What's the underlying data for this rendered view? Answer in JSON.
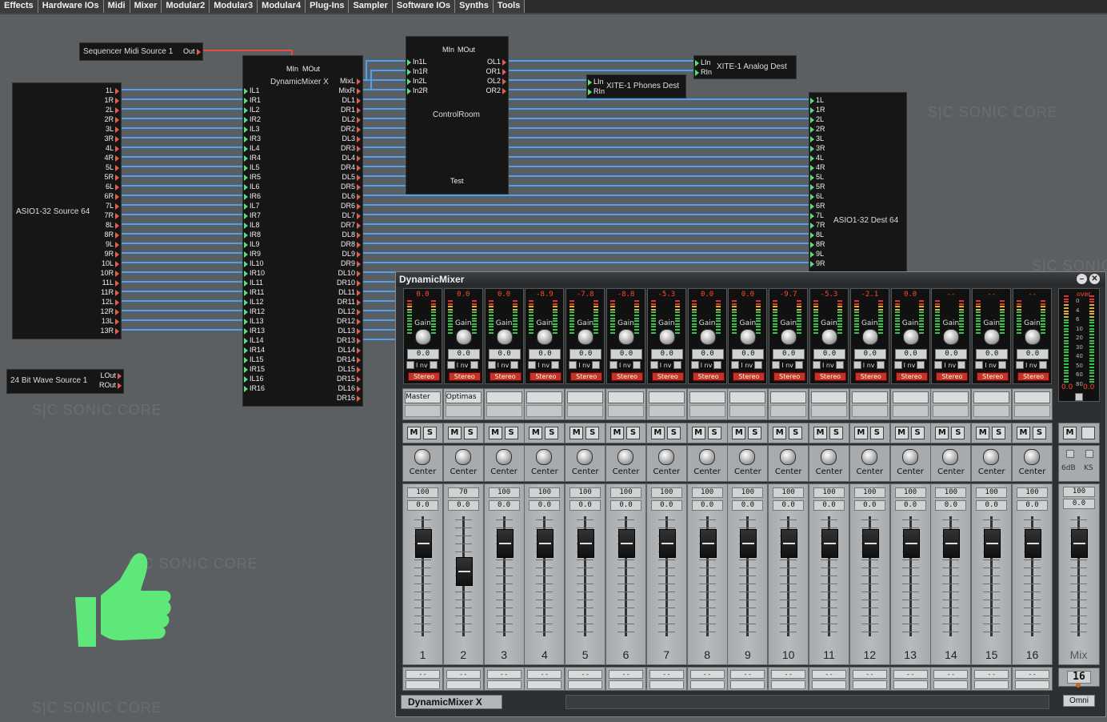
{
  "menu": [
    "Effects",
    "Hardware IOs",
    "Midi",
    "Mixer",
    "Modular2",
    "Modular3",
    "Modular4",
    "Plug-Ins",
    "Sampler",
    "Software IOs",
    "Synths",
    "Tools"
  ],
  "watermark": "S|C  SONIC CORE",
  "modules": {
    "seq": {
      "title": "Sequencer Midi Source 1",
      "out": "Out"
    },
    "asio_src": {
      "title": "ASIO1-32 Source 64",
      "ports": [
        "1L",
        "1R",
        "2L",
        "2R",
        "3L",
        "3R",
        "4L",
        "4R",
        "5L",
        "5R",
        "6L",
        "6R",
        "7L",
        "7R",
        "8L",
        "8R",
        "9L",
        "9R",
        "10L",
        "10R",
        "11L",
        "11R",
        "12L",
        "12R",
        "13L",
        "13R"
      ]
    },
    "wave": {
      "title": "24 Bit Wave Source 1",
      "ports": [
        "LOut",
        "ROut"
      ]
    },
    "dmx": {
      "title": "DynamicMixer X",
      "midi_in": "MIn",
      "midi_out": "MOut",
      "in_ports": [
        "IL1",
        "IR1",
        "IL2",
        "IR2",
        "IL3",
        "IR3",
        "IL4",
        "IR4",
        "IL5",
        "IR5",
        "IL6",
        "IR6",
        "IL7",
        "IR7",
        "IL8",
        "IR8",
        "IL9",
        "IR9",
        "IL10",
        "IR10",
        "IL11",
        "IR11",
        "IL12",
        "IR12",
        "IL13",
        "IR13",
        "IL14",
        "IR14",
        "IL15",
        "IR15",
        "IL16",
        "IR16"
      ],
      "out_ports": [
        "MixL",
        "MixR",
        "DL1",
        "DR1",
        "DL2",
        "DR2",
        "DL3",
        "DR3",
        "DL4",
        "DR4",
        "DL5",
        "DR5",
        "DL6",
        "DR6",
        "DL7",
        "DR7",
        "DL8",
        "DR8",
        "DL9",
        "DR9",
        "DL10",
        "DR10",
        "DL11",
        "DR11",
        "DL12",
        "DR12",
        "DL13",
        "DR13",
        "DL14",
        "DR14",
        "DL15",
        "DR15",
        "DL16",
        "DR16"
      ]
    },
    "cr": {
      "title": "ControlRoom",
      "midi_in": "MIn",
      "midi_out": "MOut",
      "in_ports": [
        "In1L",
        "In1R",
        "In2L",
        "In2R"
      ],
      "out_ports": [
        "OL1",
        "OR1",
        "OL2",
        "OR2"
      ],
      "test": "Test"
    },
    "xite_analog": {
      "title": "XITE-1 Analog Dest",
      "ports": [
        "LIn",
        "RIn"
      ]
    },
    "xite_phones": {
      "title": "XITE-1 Phones Dest",
      "ports": [
        "LIn",
        "RIn"
      ]
    },
    "asio_dest": {
      "title": "ASIO1-32 Dest 64",
      "ports": [
        "1L",
        "1R",
        "2L",
        "2R",
        "3L",
        "3R",
        "4L",
        "4R",
        "5L",
        "5R",
        "6L",
        "6R",
        "7L",
        "7R",
        "8L",
        "8R",
        "9L",
        "9R"
      ]
    }
  },
  "mixer": {
    "title": "DynamicMixer",
    "gain_label": "Gain",
    "inv_label": "I nv",
    "stereo_label": "Stereo",
    "mute_label": "M",
    "solo_label": "S",
    "footer": "DynamicMixer X",
    "channels": [
      {
        "num": "1",
        "peak": "0.0",
        "gain": "0.0",
        "name": "Master",
        "pan": "Center",
        "vol": "100",
        "vol_db": "0.0",
        "bottom": "- -",
        "fader": 0.78
      },
      {
        "num": "2",
        "peak": "0.0",
        "gain": "0.0",
        "name": "Optimas",
        "pan": "Center",
        "vol": "70",
        "vol_db": "0.0",
        "bottom": "- -",
        "fader": 0.55
      },
      {
        "num": "3",
        "peak": "0.0",
        "gain": "0.0",
        "name": "",
        "pan": "Center",
        "vol": "100",
        "vol_db": "0.0",
        "bottom": "- -",
        "fader": 0.78
      },
      {
        "num": "4",
        "peak": "-8.9",
        "gain": "0.0",
        "name": "",
        "pan": "Center",
        "vol": "100",
        "vol_db": "0.0",
        "bottom": "- -",
        "fader": 0.78
      },
      {
        "num": "5",
        "peak": "-7.8",
        "gain": "0.0",
        "name": "",
        "pan": "Center",
        "vol": "100",
        "vol_db": "0.0",
        "bottom": "- -",
        "fader": 0.78
      },
      {
        "num": "6",
        "peak": "-8.8",
        "gain": "0.0",
        "name": "",
        "pan": "Center",
        "vol": "100",
        "vol_db": "0.0",
        "bottom": "- -",
        "fader": 0.78
      },
      {
        "num": "7",
        "peak": "-5.3",
        "gain": "0.0",
        "name": "",
        "pan": "Center",
        "vol": "100",
        "vol_db": "0.0",
        "bottom": "- -",
        "fader": 0.78
      },
      {
        "num": "8",
        "peak": "0.0",
        "gain": "0.0",
        "name": "",
        "pan": "Center",
        "vol": "100",
        "vol_db": "0.0",
        "bottom": "- -",
        "fader": 0.78
      },
      {
        "num": "9",
        "peak": "0.0",
        "gain": "0.0",
        "name": "",
        "pan": "Center",
        "vol": "100",
        "vol_db": "0.0",
        "bottom": "- -",
        "fader": 0.78
      },
      {
        "num": "10",
        "peak": "-9.7",
        "gain": "0.0",
        "name": "",
        "pan": "Center",
        "vol": "100",
        "vol_db": "0.0",
        "bottom": "- -",
        "fader": 0.78
      },
      {
        "num": "11",
        "peak": "-5.3",
        "gain": "0.0",
        "name": "",
        "pan": "Center",
        "vol": "100",
        "vol_db": "0.0",
        "bottom": "- -",
        "fader": 0.78
      },
      {
        "num": "12",
        "peak": "-2.1",
        "gain": "0.0",
        "name": "",
        "pan": "Center",
        "vol": "100",
        "vol_db": "0.0",
        "bottom": "- -",
        "fader": 0.78
      },
      {
        "num": "13",
        "peak": "0.0",
        "gain": "0.0",
        "name": "",
        "pan": "Center",
        "vol": "100",
        "vol_db": "0.0",
        "bottom": "- -",
        "fader": 0.78
      },
      {
        "num": "14",
        "peak": "--",
        "gain": "0.0",
        "name": "",
        "pan": "Center",
        "vol": "100",
        "vol_db": "0.0",
        "bottom": "- -",
        "fader": 0.78
      },
      {
        "num": "15",
        "peak": "--",
        "gain": "0.0",
        "name": "",
        "pan": "Center",
        "vol": "100",
        "vol_db": "0.0",
        "bottom": "- -",
        "fader": 0.78
      },
      {
        "num": "16",
        "peak": "--",
        "gain": "0.0",
        "name": "",
        "pan": "Center",
        "vol": "100",
        "vol_db": "0.0",
        "bottom": "- -",
        "fader": 0.78
      }
    ],
    "master": {
      "over": "over",
      "scale": [
        "0",
        "4",
        "6",
        "10",
        "20",
        "30",
        "40",
        "50",
        "60",
        "80"
      ],
      "peak_l": "0.0",
      "peak_r": "0.0",
      "six_db": "6dB",
      "ks": "KS",
      "vol": "100",
      "vol_db": "0.0",
      "label": "Mix",
      "midi_ch": "16",
      "omni": "Omni",
      "fader": 0.78
    }
  },
  "colors": {
    "wire_audio": "#4aa3f0",
    "wire_midi": "#e4503c",
    "thumb": "#5fe87a",
    "port_out": "#e0604e",
    "port_in": "#59e07a"
  }
}
